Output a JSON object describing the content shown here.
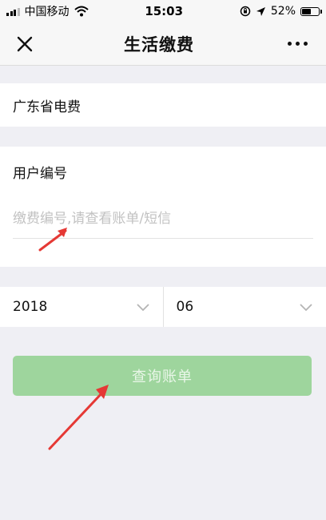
{
  "status_bar": {
    "carrier": "中国移动",
    "time": "15:03",
    "battery_percent": "52%",
    "icons": [
      "signal-icon",
      "wifi-icon",
      "orientation-lock-icon",
      "location-icon",
      "battery-icon"
    ]
  },
  "nav": {
    "title": "生活缴费",
    "close_icon": "close-icon",
    "more_icon": "more-icon"
  },
  "provider": {
    "name": "广东省电费"
  },
  "account": {
    "label": "用户编号",
    "placeholder": "缴费编号,请查看账单/短信",
    "value": ""
  },
  "date": {
    "year": "2018",
    "month": "06"
  },
  "query_button": {
    "label": "查询账单"
  },
  "colors": {
    "button_bg": "#9ed59d",
    "annotation_arrow": "#e53935",
    "page_bg": "#efeff4"
  }
}
